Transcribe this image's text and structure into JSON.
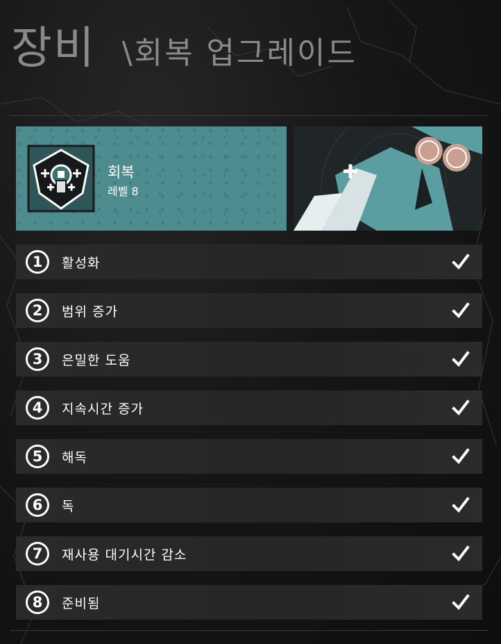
{
  "header": {
    "title": "장비",
    "subtitle": "\\회복 업그레이드"
  },
  "item": {
    "name": "회복",
    "level": "레벨 8",
    "emblem_icon": "medic-kit-hexagon-icon",
    "art": "character-art"
  },
  "upgrades": [
    {
      "number": "1",
      "label": "활성화",
      "completed": true
    },
    {
      "number": "2",
      "label": "범위 증가",
      "completed": true
    },
    {
      "number": "3",
      "label": "은밀한 도움",
      "completed": true
    },
    {
      "number": "4",
      "label": "지속시간 증가",
      "completed": true
    },
    {
      "number": "5",
      "label": "해독",
      "completed": true
    },
    {
      "number": "6",
      "label": "독",
      "completed": true
    },
    {
      "number": "7",
      "label": "재사용 대기시간 감소",
      "completed": true
    },
    {
      "number": "8",
      "label": "준비됨",
      "completed": true
    }
  ],
  "colors": {
    "banner": "#4d8c8f",
    "row": "#2a2a2a",
    "text": "#ffffff",
    "title": "#8a8a8a"
  }
}
